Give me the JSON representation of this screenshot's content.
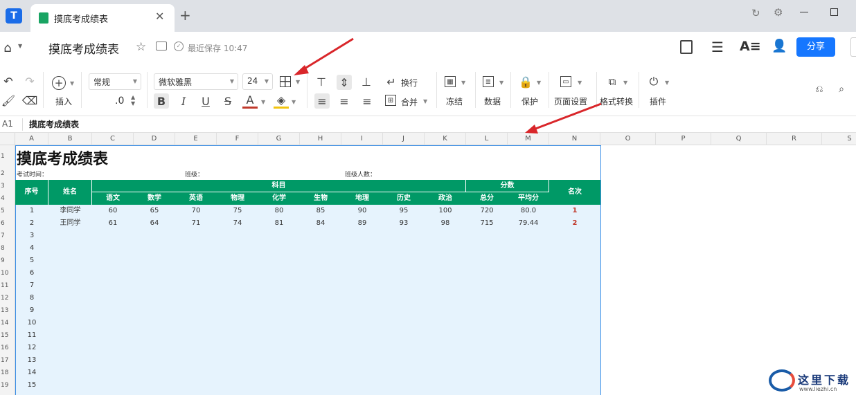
{
  "tab": {
    "title": "摸底考成绩表"
  },
  "title_bar": {
    "doc_title": "摸底考成绩表",
    "save_status": "最近保存 10:47",
    "share_label": "分享"
  },
  "toolbar": {
    "insert_label": "插入",
    "number_format": "常规",
    "decimal": ".0",
    "font_name": "微软雅黑",
    "font_size": "24",
    "wrap_label": "换行",
    "merge_label": "合并",
    "freeze_label": "冻结",
    "data_label": "数据",
    "protect_label": "保护",
    "page_setup_label": "页面设置",
    "format_convert_label": "格式转换",
    "plugin_label": "插件"
  },
  "formula_bar": {
    "cell_ref": "A1",
    "content": "摸底考成绩表"
  },
  "columns": [
    "A",
    "B",
    "C",
    "D",
    "E",
    "F",
    "G",
    "H",
    "I",
    "J",
    "K",
    "L",
    "M",
    "N",
    "O",
    "P",
    "Q",
    "R",
    "S"
  ],
  "rows": [
    "1",
    "2",
    "3",
    "4",
    "5",
    "6",
    "7",
    "8",
    "9",
    "10",
    "11",
    "12",
    "13",
    "14",
    "15",
    "16",
    "17",
    "18",
    "19"
  ],
  "sheet": {
    "title": "摸底考成绩表",
    "exam_time": "考试时间：",
    "class": "班级：",
    "class_count": "班级人数：",
    "hdr_no": "序号",
    "hdr_name": "姓名",
    "hdr_subjects": "科目",
    "hdr_scores": "分数",
    "hdr_rank": "名次",
    "subjects": [
      "语文",
      "数学",
      "英语",
      "物理",
      "化学",
      "生物",
      "地理",
      "历史",
      "政治",
      "总分",
      "平均分"
    ],
    "students": [
      {
        "no": "1",
        "name": "李同学",
        "scores": [
          "60",
          "65",
          "70",
          "75",
          "80",
          "85",
          "90",
          "95",
          "100",
          "720",
          "80.0"
        ],
        "rank": "1"
      },
      {
        "no": "2",
        "name": "王同学",
        "scores": [
          "61",
          "64",
          "71",
          "74",
          "81",
          "84",
          "89",
          "93",
          "98",
          "715",
          "79.44"
        ],
        "rank": "2"
      }
    ],
    "empty_numbers": [
      "3",
      "4",
      "5",
      "6",
      "7",
      "8",
      "9",
      "10",
      "11",
      "12",
      "13",
      "14",
      "15"
    ]
  },
  "watermark": {
    "text": "这里下载",
    "url": "www.liezhi.cn"
  },
  "colors": {
    "accent": "#1677ff",
    "header_green": "#009966",
    "rank_red": "#c0392b",
    "selection": "#e6f3fd"
  }
}
